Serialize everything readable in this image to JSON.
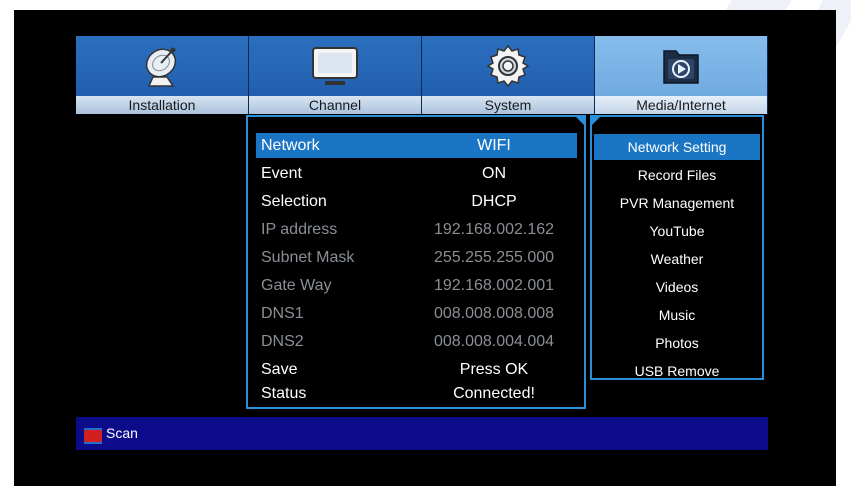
{
  "tabs": [
    {
      "label": "Installation",
      "icon": "satellite-dish-icon",
      "active": false
    },
    {
      "label": "Channel",
      "icon": "tv-icon",
      "active": false
    },
    {
      "label": "System",
      "icon": "gear-icon",
      "active": false
    },
    {
      "label": "Media/Internet",
      "icon": "media-folder-icon",
      "active": true
    }
  ],
  "settings": {
    "rows": [
      {
        "label": "Network",
        "value": "WIFI"
      },
      {
        "label": "Event",
        "value": "ON"
      },
      {
        "label": "Selection",
        "value": "DHCP"
      },
      {
        "label": "IP address",
        "value": "192.168.002.162"
      },
      {
        "label": "Subnet Mask",
        "value": "255.255.255.000"
      },
      {
        "label": "Gate Way",
        "value": "192.168.002.001"
      },
      {
        "label": "DNS1",
        "value": "008.008.008.008"
      },
      {
        "label": "DNS2",
        "value": "008.008.004.004"
      },
      {
        "label": "Save",
        "value": "Press OK"
      },
      {
        "label": "Status",
        "value": "Connected!"
      }
    ]
  },
  "submenu": {
    "items": [
      "Network Setting",
      "Record Files",
      "PVR Management",
      "YouTube",
      "Weather",
      "Videos",
      "Music",
      "Photos",
      "USB Remove"
    ]
  },
  "helpbar": {
    "key_color": "red",
    "label": "Scan"
  },
  "colors": {
    "highlight": "#1a76c4",
    "border": "#2a8fd8",
    "helpbar": "#0c0c8a",
    "disabled_text": "#8a8f95"
  }
}
